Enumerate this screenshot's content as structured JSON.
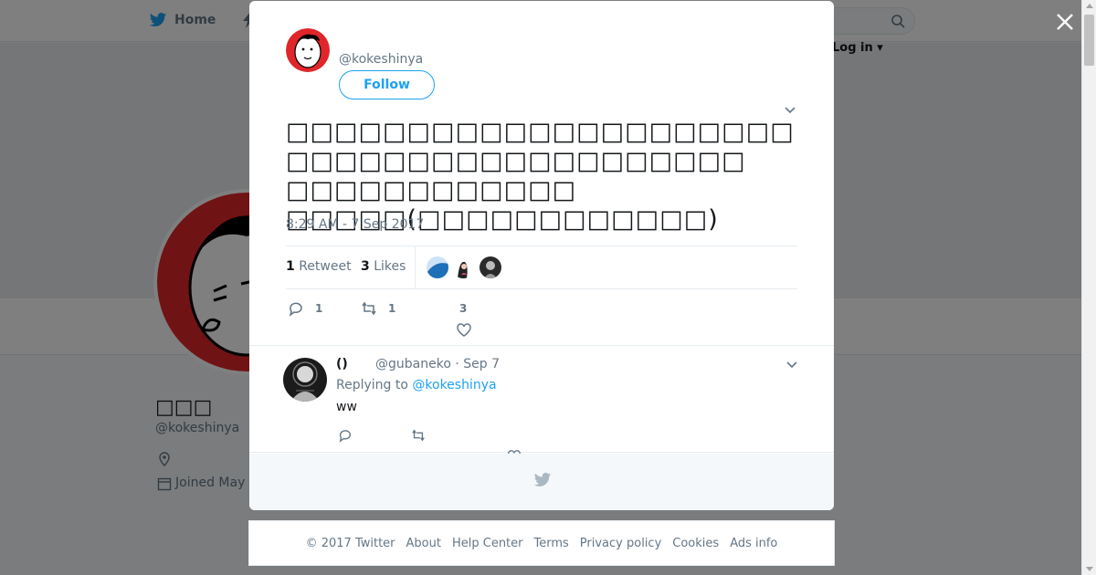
{
  "background": {
    "nav": {
      "home_label": "Home",
      "login_label": "Log in"
    },
    "profile": {
      "name": "□□□",
      "handle": "@kokeshinya",
      "joined": "Joined May"
    }
  },
  "tweet": {
    "handle": "@kokeshinya",
    "follow_label": "Follow",
    "text": "□□□□□□□□□□□□□□□□□□□□□□□□□□□□□□□□□□□□□□□□\n□□□□□□□□□□□□\n□□□□□(□□□□□□□□□□□□)",
    "timestamp": "8:29 AM - 7 Sep 2017",
    "retweets": {
      "count": "1",
      "label": "Retweet"
    },
    "likes": {
      "count": "3",
      "label": "Likes"
    },
    "action_counts": {
      "reply": "1",
      "retweet": "1",
      "like": "3"
    }
  },
  "reply": {
    "name": "()",
    "handle_time": "@gubaneko · Sep 7",
    "replying_prefix": "Replying to",
    "replying_to": "@kokeshinya",
    "text": "ww"
  },
  "footer": {
    "links": [
      "© 2017 Twitter",
      "About",
      "Help Center",
      "Terms",
      "Privacy policy",
      "Cookies",
      "Ads info"
    ]
  },
  "colors": {
    "accent": "#1da1f2",
    "muted": "#657786",
    "overlay": "rgba(0,0,0,0.5)",
    "avatar_red": "#e0262b"
  },
  "icons": [
    "twitter-bird-icon",
    "moments-icon",
    "search-icon",
    "close-icon",
    "chevron-down-icon",
    "reply-icon",
    "retweet-icon",
    "heart-icon",
    "location-icon",
    "calendar-icon"
  ]
}
